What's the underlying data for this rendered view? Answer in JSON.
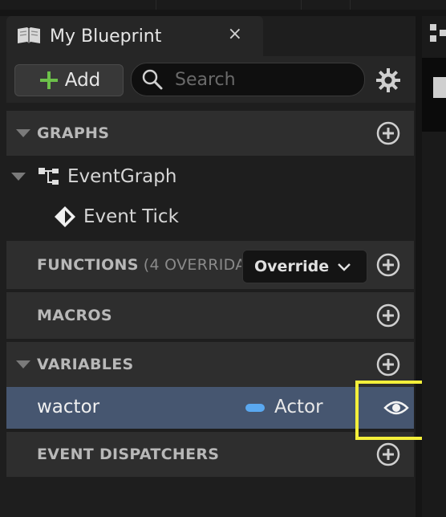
{
  "tab": {
    "title": "My Blueprint",
    "close_glyph": "×",
    "icon": "blueprint-book-icon"
  },
  "toolbar": {
    "add_label": "Add",
    "search_placeholder": "Search",
    "settings_icon": "gear-icon"
  },
  "sections": {
    "graphs": {
      "label": "GRAPHS"
    },
    "functions": {
      "label": "FUNCTIONS",
      "suffix": "(4 OVERRIDABLE)",
      "override_label": "Override"
    },
    "macros": {
      "label": "MACROS"
    },
    "variables": {
      "label": "VARIABLES"
    },
    "event_dispatchers": {
      "label": "EVENT DISPATCHERS"
    }
  },
  "graphs": [
    {
      "label": "EventGraph",
      "icon": "graph-icon"
    },
    {
      "label": "Event Tick",
      "icon": "event-diamond-icon"
    }
  ],
  "variables": [
    {
      "name": "wactor",
      "type": "Actor",
      "type_color": "#5aa8f0",
      "visibility_icon": "eye-icon"
    }
  ],
  "colors": {
    "accent_green": "#6cc04a",
    "selection": "#465670",
    "highlight_box": "#f3ef3a"
  }
}
